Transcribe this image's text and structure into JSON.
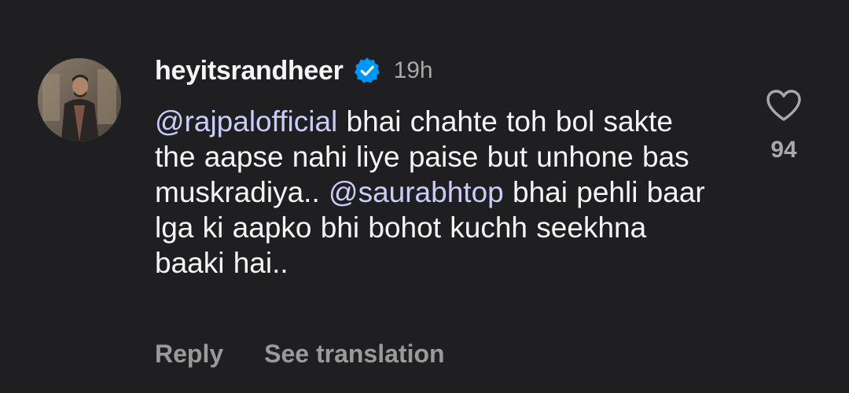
{
  "comment": {
    "username": "heyitsrandheer",
    "verified": true,
    "timestamp": "19h",
    "segments": [
      {
        "type": "mention",
        "text": "@rajpalofficial"
      },
      {
        "type": "text",
        "text": " bhai chahte toh bol sakte the aapse nahi liye paise but unhone bas muskradiya.. "
      },
      {
        "type": "mention",
        "text": "@saurabhtop"
      },
      {
        "type": "text",
        "text": " bhai pehli baar lga ki aapko bhi bohot kuchh seekhna baaki hai.."
      }
    ],
    "like_count": "94"
  },
  "actions": {
    "reply_label": "Reply",
    "translate_label": "See translation"
  },
  "icons": {
    "like": "heart-outline-icon",
    "verified": "verified-badge-icon",
    "avatar": "user-avatar"
  },
  "colors": {
    "background": "#1f1f21",
    "verified_blue": "#0095f6",
    "muted_text": "#a8a8a8"
  }
}
